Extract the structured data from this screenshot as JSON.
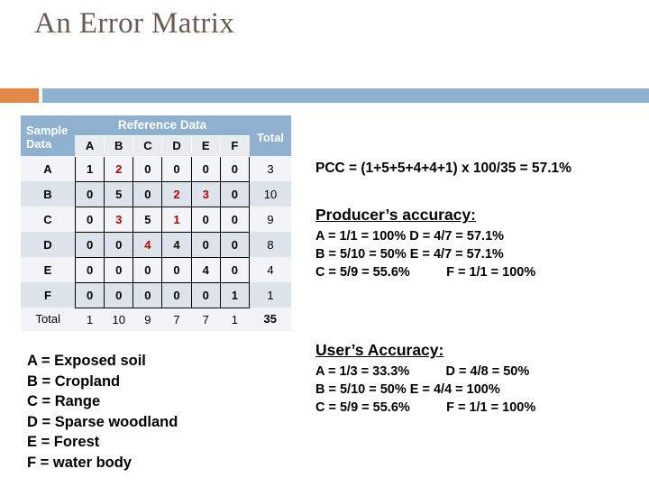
{
  "slide": {
    "title": "An Error Matrix"
  },
  "accents": {
    "orange": "#e0884a",
    "blue": "#8fb0ce",
    "title_color": "#6b5b53",
    "error_red": "#c00000"
  },
  "matrix": {
    "corner_header": "Sample Data",
    "reference_header": "Reference Data",
    "total_header": "Total",
    "columns": [
      "A",
      "B",
      "C",
      "D",
      "E",
      "F"
    ],
    "rows": [
      {
        "label": "A",
        "values": [
          "1",
          "2",
          "0",
          "0",
          "0",
          "0"
        ],
        "errors": [
          false,
          true,
          false,
          false,
          false,
          false
        ],
        "total": "3"
      },
      {
        "label": "B",
        "values": [
          "0",
          "5",
          "0",
          "2",
          "3",
          "0"
        ],
        "errors": [
          false,
          false,
          false,
          true,
          true,
          false
        ],
        "total": "10"
      },
      {
        "label": "C",
        "values": [
          "0",
          "3",
          "5",
          "1",
          "0",
          "0"
        ],
        "errors": [
          false,
          true,
          false,
          true,
          false,
          false
        ],
        "total": "9"
      },
      {
        "label": "D",
        "values": [
          "0",
          "0",
          "4",
          "4",
          "0",
          "0"
        ],
        "errors": [
          false,
          false,
          true,
          false,
          false,
          false
        ],
        "total": "8"
      },
      {
        "label": "E",
        "values": [
          "0",
          "0",
          "0",
          "0",
          "4",
          "0"
        ],
        "errors": [
          false,
          false,
          false,
          false,
          false,
          false
        ],
        "total": "4"
      },
      {
        "label": "F",
        "values": [
          "0",
          "0",
          "0",
          "0",
          "0",
          "1"
        ],
        "errors": [
          false,
          false,
          false,
          false,
          false,
          false
        ],
        "total": "1"
      }
    ],
    "total_row": {
      "label": "Total",
      "values": [
        "1",
        "10",
        "9",
        "7",
        "7",
        "1"
      ],
      "grand_total": "35"
    }
  },
  "legend": {
    "lines": [
      "A = Exposed soil",
      "B = Cropland",
      "C = Range",
      "D = Sparse woodland",
      "E = Forest",
      "F = water body"
    ]
  },
  "pcc": {
    "text": "PCC = (1+5+5+4+4+1) x 100/35 = 57.1%"
  },
  "producer_accuracy": {
    "title": "Producer’s accuracy:",
    "rows": [
      "A = 1/1 = 100% D = 4/7 = 57.1%",
      "B = 5/10 = 50% E = 4/7 = 57.1%",
      "C = 5/9 = 55.6%          F = 1/1 = 100%"
    ]
  },
  "user_accuracy": {
    "title": "User’s Accuracy:",
    "rows": [
      "A = 1/3 = 33.3%          D = 4/8 = 50%",
      "B = 5/10 = 50% E = 4/4 = 100%",
      "C = 5/9 = 55.6%          F = 1/1 = 100%"
    ]
  }
}
